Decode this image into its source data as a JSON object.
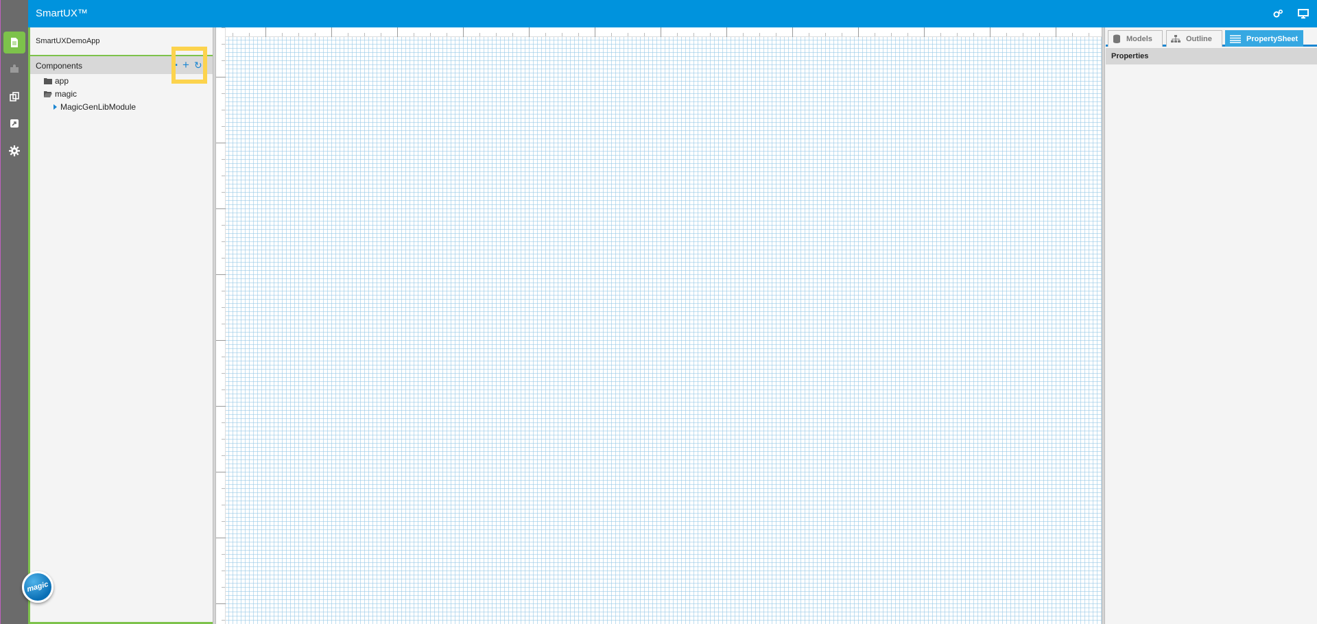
{
  "app": {
    "title": "SmartUX™"
  },
  "rail": {
    "items": [
      {
        "icon": "document-icon",
        "active": true
      },
      {
        "icon": "puzzle-icon",
        "active": false
      },
      {
        "icon": "copy-icon",
        "active": false
      },
      {
        "icon": "share-icon",
        "active": false
      },
      {
        "icon": "gear-icon",
        "active": false
      }
    ],
    "logo_text": "magic"
  },
  "header": {
    "icons": [
      "settings-cogs-icon",
      "monitor-icon"
    ]
  },
  "left_panel": {
    "project_name": "SmartUXDemoApp",
    "components_title": "Components",
    "tree": [
      {
        "label": "app",
        "icon": "folder-icon",
        "level": 1
      },
      {
        "label": "magic",
        "icon": "folder-open-icon",
        "level": 1
      },
      {
        "label": "MagicGenLibModule",
        "icon": "caret-right-icon",
        "level": 2
      }
    ]
  },
  "right_panel": {
    "tabs": [
      {
        "label": "Models",
        "icon": "database-icon",
        "active": false
      },
      {
        "label": "Outline",
        "icon": "sitemap-icon",
        "active": false
      },
      {
        "label": "PropertySheet",
        "icon": "list-icon",
        "active": true
      }
    ],
    "properties_title": "Properties"
  },
  "colors": {
    "header": "#0093dd",
    "accent_green": "#7dc24b",
    "highlight_yellow": "#fcd34d",
    "tab_active": "#36a8e2"
  }
}
